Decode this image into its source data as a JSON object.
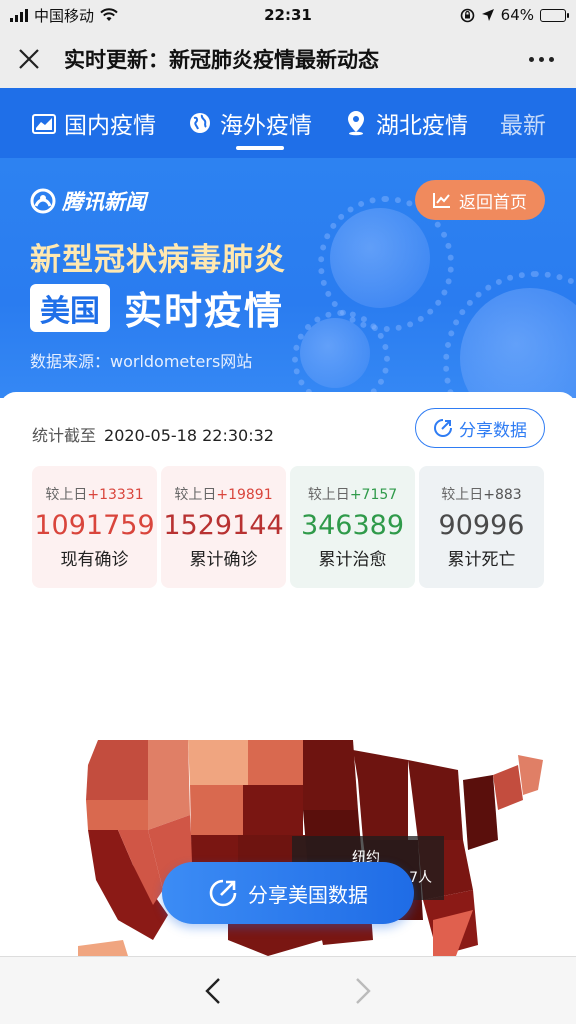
{
  "status_bar": {
    "carrier": "中国移动",
    "time": "22:31",
    "battery_percent": "64%",
    "battery_level": 0.64
  },
  "nav": {
    "title": "实时更新：新冠肺炎疫情最新动态"
  },
  "tabs": [
    {
      "label": "国内疫情",
      "icon": "chart-icon"
    },
    {
      "label": "海外疫情",
      "icon": "globe-icon",
      "active": true
    },
    {
      "label": "湖北疫情",
      "icon": "location-pin-icon"
    },
    {
      "label": "最新"
    }
  ],
  "banner": {
    "brand": "腾讯新闻",
    "home_button": "返回首页",
    "title": "新型冠状病毒肺炎",
    "region_tag": "美国",
    "subtitle": "实时疫情",
    "source": "数据来源：worldometers网站"
  },
  "stats": {
    "time_label": "统计截至",
    "time_value": "2020-05-18 22:30:32",
    "share_button": "分享数据",
    "delta_prefix": "较上日",
    "items": [
      {
        "delta": "+13331",
        "value": "1091759",
        "label": "现有确诊"
      },
      {
        "delta": "+19891",
        "value": "1529144",
        "label": "累计确诊"
      },
      {
        "delta": "+7157",
        "value": "346389",
        "label": "累计治愈"
      },
      {
        "delta": "+883",
        "value": "90996",
        "label": "累计死亡"
      }
    ]
  },
  "map": {
    "tooltip_name": "纽约",
    "tooltip_value": "7人"
  },
  "share_us_button": "分享美国数据",
  "colors": {
    "primary": "#1f6fe8",
    "confirmed": "#d9453c",
    "cured": "#2f9a4a",
    "death": "#4a4a4a",
    "home_button": "#f08a5d"
  }
}
